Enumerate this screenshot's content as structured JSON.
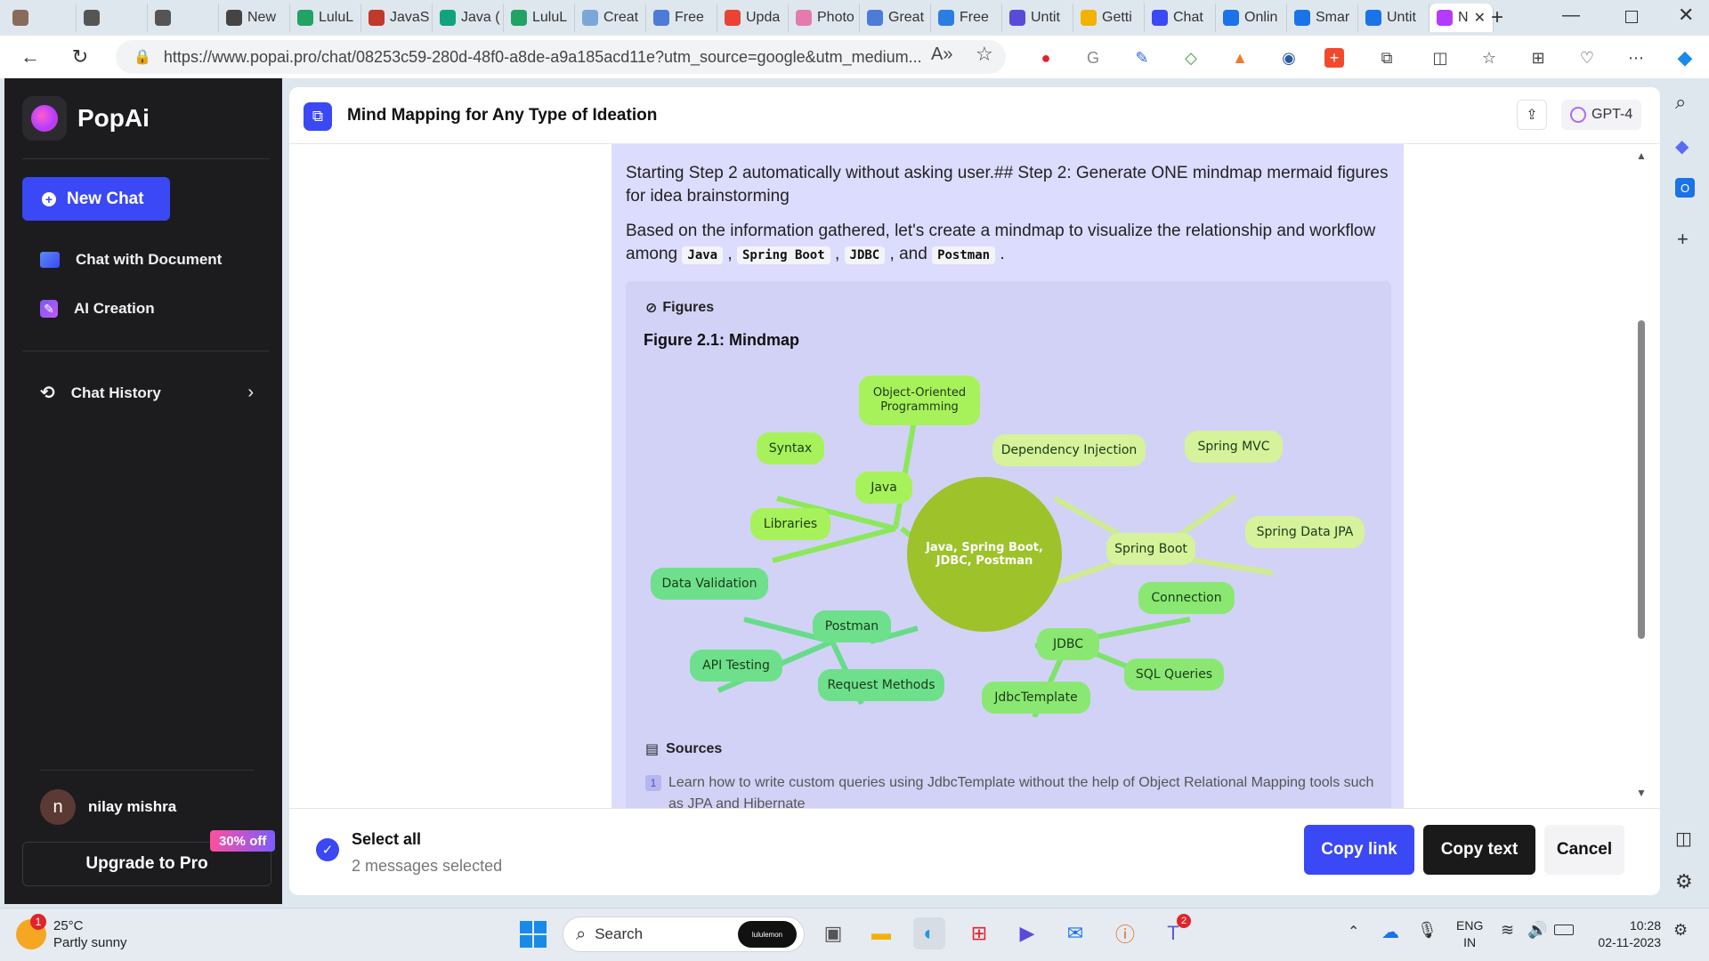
{
  "browser": {
    "tabs": [
      {
        "label": "",
        "color": "#8a6a5a"
      },
      {
        "label": "",
        "color": "#555"
      },
      {
        "label": "",
        "color": "#555"
      },
      {
        "label": "New",
        "color": "#444"
      },
      {
        "label": "LuluL",
        "color": "#21a366"
      },
      {
        "label": "JavaS",
        "color": "#c0392b"
      },
      {
        "label": "Java (",
        "color": "#10a37f"
      },
      {
        "label": "LuluL",
        "color": "#21a366"
      },
      {
        "label": "Creat",
        "color": "#7aa7d8"
      },
      {
        "label": "Free",
        "color": "#4a7cd8"
      },
      {
        "label": "Upda",
        "color": "#ea4335"
      },
      {
        "label": "Photo",
        "color": "#e57ab0"
      },
      {
        "label": "Great",
        "color": "#4a7cd8"
      },
      {
        "label": "Free",
        "color": "#2a7de1"
      },
      {
        "label": "Untit",
        "color": "#5a4ad8"
      },
      {
        "label": "Getti",
        "color": "#f2b200"
      },
      {
        "label": "Chat",
        "color": "#3a48f5"
      },
      {
        "label": "Onlin",
        "color": "#1a73e8"
      },
      {
        "label": "Smar",
        "color": "#1a73e8"
      },
      {
        "label": "Untit",
        "color": "#1a73e8"
      },
      {
        "label": "N",
        "color": "#b23cff"
      }
    ],
    "url": "https://www.popai.pro/chat/08253c59-280d-48f0-a8de-a9a185acd11e?utm_source=google&utm_medium..."
  },
  "sidebar": {
    "brand": "PopAi",
    "new_chat": "New Chat",
    "items": [
      {
        "label": "Chat with Document"
      },
      {
        "label": "AI Creation"
      },
      {
        "label": "Chat History"
      }
    ],
    "user_initial": "n",
    "user_name": "nilay mishra",
    "upgrade": "Upgrade to Pro",
    "discount": "30% off"
  },
  "header": {
    "title": "Mind Mapping for Any Type of Ideation",
    "model": "GPT-4"
  },
  "message": {
    "para1": "Starting Step 2 automatically without asking user.## Step 2: Generate ONE mindmap mermaid figures for idea brainstorming",
    "para2_prefix": "Based on the information gathered, let's create a mindmap to visualize the relationship and workflow among",
    "codes": [
      "Java",
      "Spring Boot",
      "JDBC",
      "Postman"
    ],
    "sep_comma": ",",
    "sep_and": ", and",
    "end": ".",
    "figures_label": "Figures",
    "figure_title": "Figure 2.1: Mindmap",
    "sources_label": "Sources",
    "source_index": "1",
    "source_text": "Learn how to write custom queries using JdbcTemplate without the help of Object Relational Mapping tools such as JPA and Hibernate"
  },
  "mindmap": {
    "center": "Java, Spring Boot, JDBC, Postman",
    "nodes": [
      "Java",
      "Object-Oriented Programming",
      "Syntax",
      "Libraries",
      "Spring Boot",
      "Dependency Injection",
      "Spring MVC",
      "Spring Data JPA",
      "JDBC",
      "Connection",
      "SQL Queries",
      "JdbcTemplate",
      "Postman",
      "Data Validation",
      "API Testing",
      "Request Methods"
    ]
  },
  "bottom": {
    "select_all": "Select all",
    "selected_count": "2 messages selected",
    "copy_link": "Copy link",
    "copy_text": "Copy text",
    "cancel": "Cancel"
  },
  "taskbar": {
    "temp": "25°C",
    "weather": "Partly sunny",
    "weather_badge": "1",
    "search": "Search",
    "search_pill": "lululemon",
    "teams_badge": "2",
    "lang1": "ENG",
    "lang2": "IN",
    "time": "10:28",
    "date": "02-11-2023"
  },
  "colors": {
    "accent": "#3a48f5",
    "sidebar_bg": "#1c1c1e",
    "message_bg": "#dcdcff",
    "java_node": "#a7f25a",
    "spring_node": "#d6f29a",
    "jdbc_node": "#8ae872",
    "postman_node": "#6ee08c",
    "center_node": "#9dc22a",
    "discount_gradient_start": "#ff4f9e",
    "discount_gradient_end": "#7b5cff"
  }
}
